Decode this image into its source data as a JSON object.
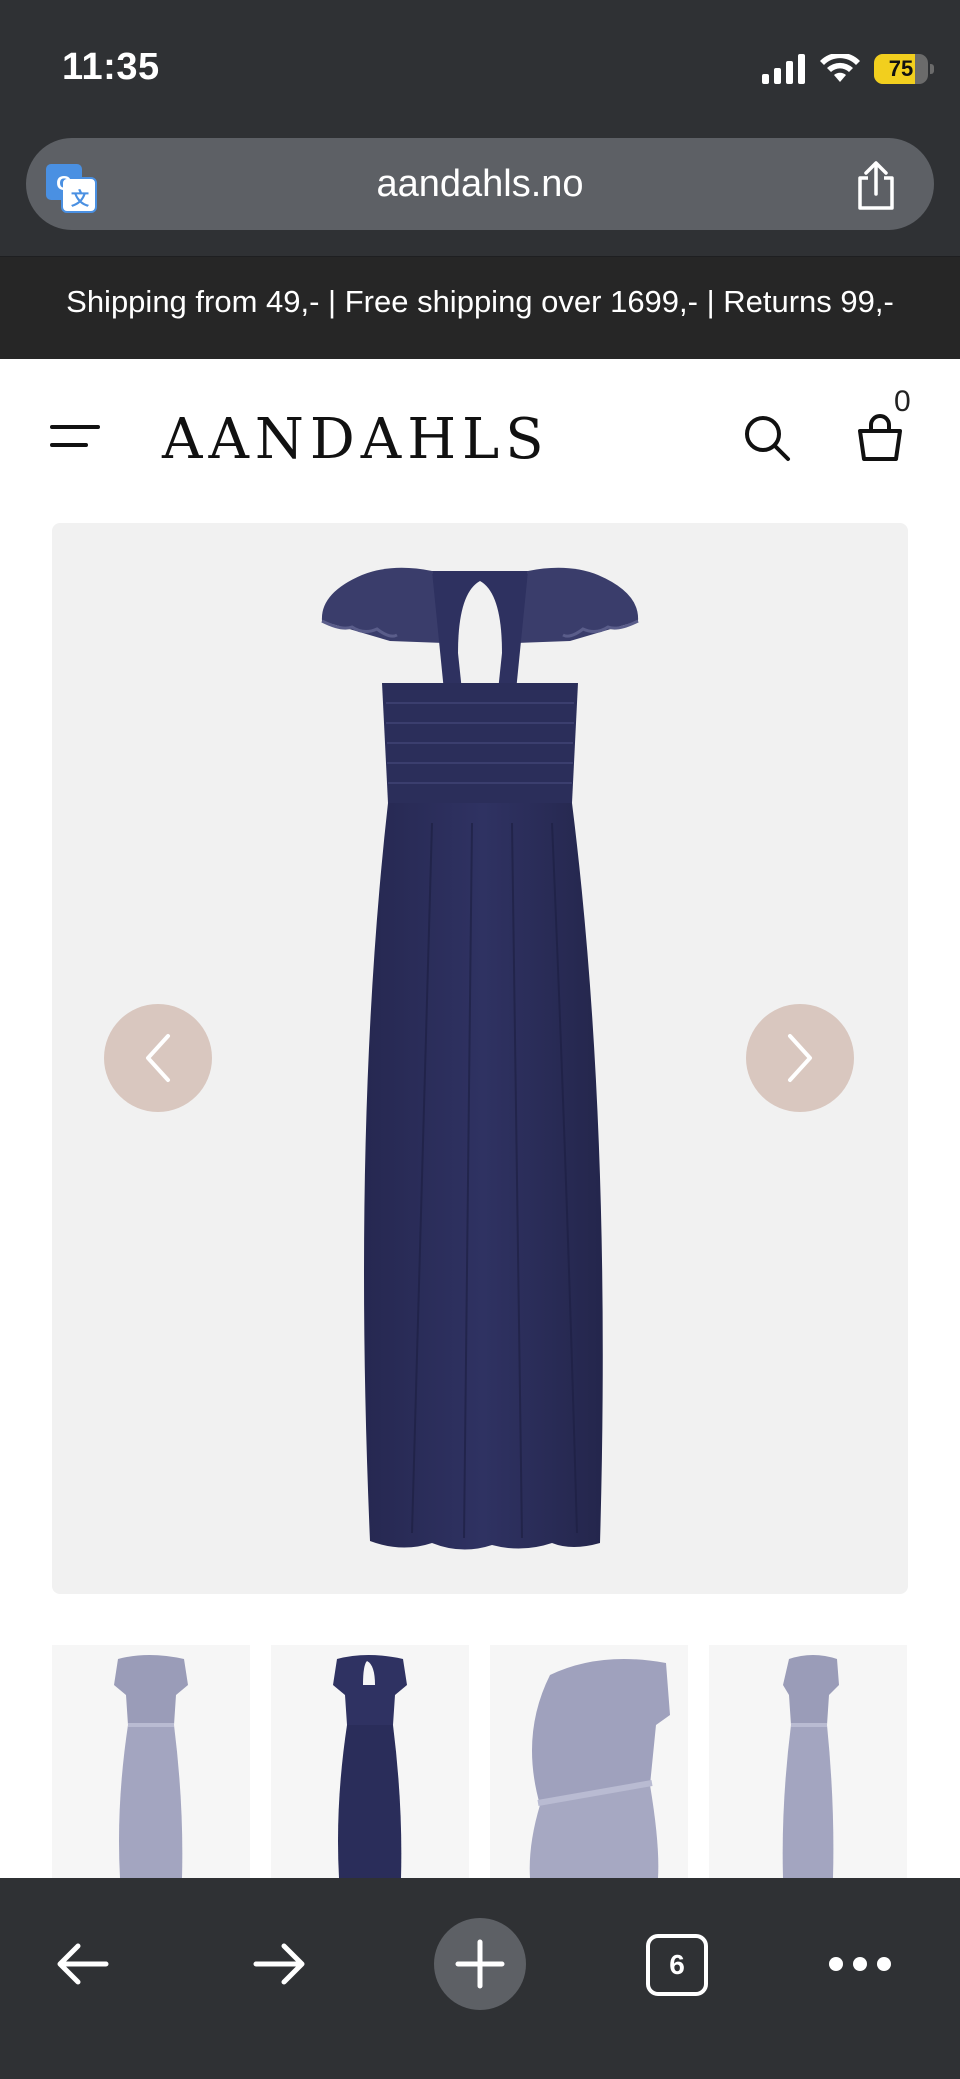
{
  "status_bar": {
    "time": "11:35",
    "battery_level": "75"
  },
  "browser": {
    "url": "aandahls.no",
    "tab_count": "6"
  },
  "promo": {
    "text": "Shipping from 49,- | Free shipping over 1699,- | Returns 99,-"
  },
  "header": {
    "logo": "AANDAHLS",
    "cart_count": "0"
  },
  "colors": {
    "dress": "#2c2f58",
    "accent_button": "#d9c7bf",
    "chrome": "#2f3134"
  },
  "icons": [
    "translate-icon",
    "share-icon",
    "menu-icon",
    "search-icon",
    "cart-icon",
    "chevron-left-icon",
    "chevron-right-icon",
    "back-arrow-icon",
    "forward-arrow-icon",
    "plus-icon",
    "more-icon"
  ]
}
